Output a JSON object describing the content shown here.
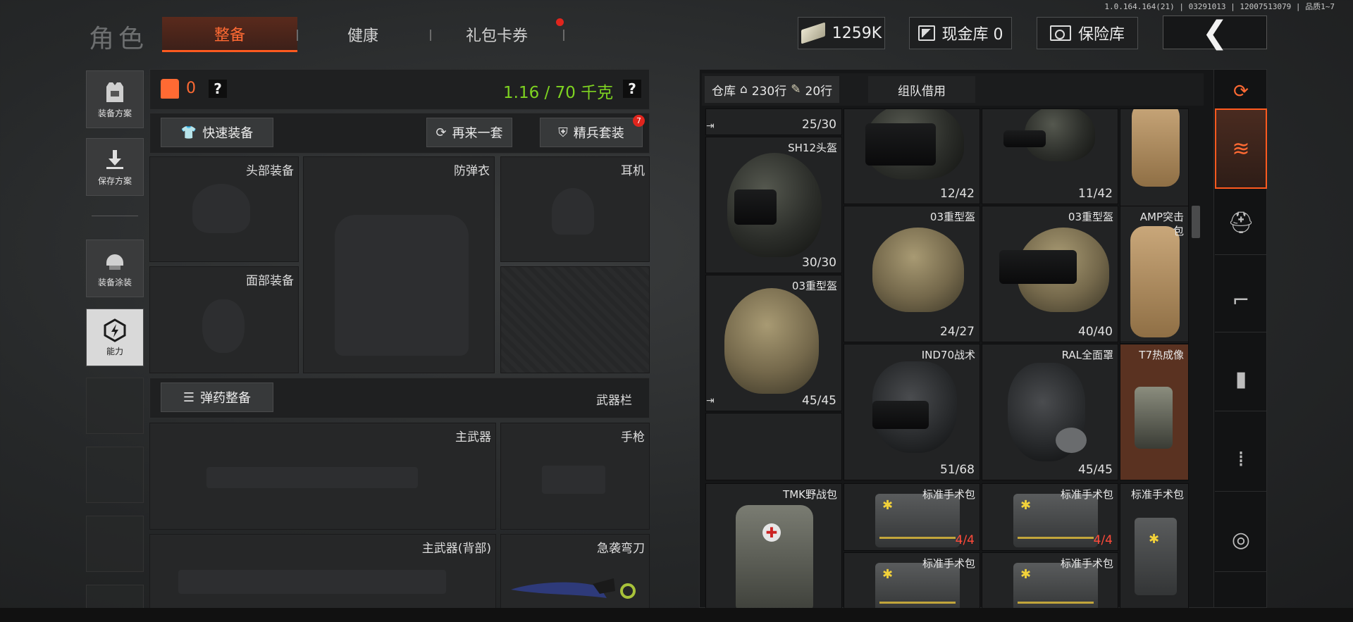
{
  "version": "1.0.164.164(21) | 03291013 | 12007513079 | 品质1~7",
  "header": {
    "title": "角色",
    "tabs": [
      {
        "label": "整备",
        "active": true
      },
      {
        "label": "健康",
        "active": false
      },
      {
        "label": "礼包卡券",
        "active": false,
        "notification": true
      }
    ],
    "money": "1259K",
    "cash_vault": "现金库 0",
    "safe": "保险库"
  },
  "sidebar": {
    "items": [
      {
        "label": "装备方案",
        "icon": "vest-plan-icon"
      },
      {
        "label": "保存方案",
        "icon": "download-icon"
      },
      {
        "label": "装备涂装",
        "icon": "helmet-skin-icon"
      },
      {
        "label": "能力",
        "icon": "ability-icon",
        "selected": true
      }
    ]
  },
  "loadout": {
    "armor_count": "0",
    "weight": "1.16 / 70 千克",
    "quick_equip": "快速装备",
    "again": "再来一套",
    "elite_set": "精兵套装",
    "elite_badge": "7",
    "slots": {
      "head": "头部装备",
      "armor": "防弹衣",
      "earphone": "耳机",
      "face": "面部装备",
      "ammo_btn": "弹药整备",
      "weapon_bar": "武器栏",
      "primary": "主武器",
      "pistol": "手枪",
      "primary_back": "主武器(背部)",
      "knife": "急袭弯刀"
    }
  },
  "warehouse": {
    "tab_label": "仓库",
    "rows_total": "230行",
    "rows_used": "20行",
    "team_borrow": "组队借用",
    "items": [
      {
        "name": "",
        "durability": "25/30"
      },
      {
        "name": "",
        "durability": "12/42"
      },
      {
        "name": "",
        "durability": "11/42"
      },
      {
        "name": "SH12头盔",
        "durability": "30/30"
      },
      {
        "name": "03重型盔",
        "durability": "24/27"
      },
      {
        "name": "03重型盔",
        "durability": "40/40"
      },
      {
        "name": "AMP突击",
        "extra": "包"
      },
      {
        "name": "03重型盔",
        "durability": "45/45"
      },
      {
        "name": "IND70战术",
        "durability": "51/68"
      },
      {
        "name": "RAL全面罩",
        "durability": "45/45"
      },
      {
        "name": "T7热成像",
        "durability": ""
      },
      {
        "name": "TMK野战包",
        "durability": ""
      },
      {
        "name": "标准手术包",
        "durability": "4/4"
      },
      {
        "name": "标准手术包",
        "durability": "4/4"
      },
      {
        "name": "标准手术包",
        "durability": ""
      },
      {
        "name": "标准手术包",
        "durability": ""
      },
      {
        "name": "标准手术包",
        "durability": ""
      }
    ]
  },
  "categories": [
    {
      "icon": "stack-refresh-icon"
    },
    {
      "icon": "stack-active-icon",
      "active": true
    },
    {
      "icon": "helmet-icon"
    },
    {
      "icon": "rifle-icon"
    },
    {
      "icon": "magazine-icon"
    },
    {
      "icon": "ammo-icon"
    },
    {
      "icon": "scope-icon"
    }
  ],
  "colors": {
    "accent": "#ff5a1f",
    "weight_green": "#7ed321",
    "badge_red": "#e0251d",
    "durability_red": "#ff4a3a"
  }
}
